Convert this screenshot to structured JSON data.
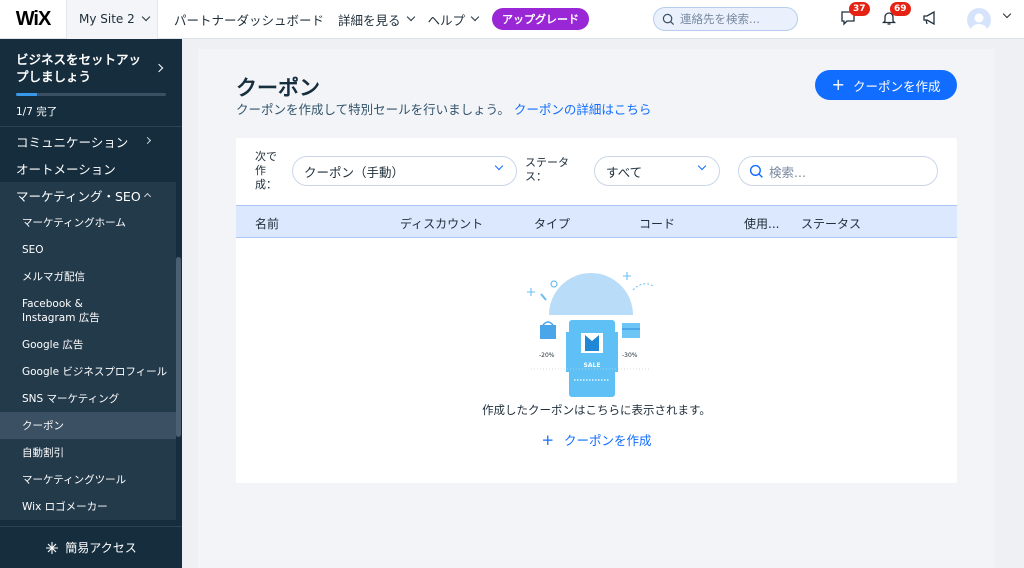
{
  "topbar": {
    "logo": "WiX",
    "site_name": "My Site 2",
    "nav": [
      "パートナーダッシュボード",
      "詳細を見る",
      "ヘルプ"
    ],
    "upgrade": "アップグレード",
    "search_placeholder": "連絡先を検索...",
    "chat_badge": "37",
    "notif_badge": "69"
  },
  "sidebar": {
    "setup_title": "ビジネスをセットアップしましょう",
    "setup_progress": 0.14,
    "setup_count": "1/7 完了",
    "items": [
      "コミュニケーション",
      "オートメーション"
    ],
    "group_label": "マーケティング・SEO",
    "sub_items": [
      "マーケティングホーム",
      "SEO",
      "メルマガ配信",
      "Facebook & Instagram 広告",
      "Google 広告",
      "Google ビジネスプロフィール",
      "SNS マーケティング",
      "クーポン",
      "自動割引",
      "マーケティングツール",
      "Wix ロゴメーカー"
    ],
    "quick_access": "簡易アクセス"
  },
  "page": {
    "title": "クーポン",
    "subtitle": "クーポンを作成して特別セールを行いましょう。",
    "subtitle_link": "クーポンの詳細はこちら",
    "create_button": "クーポンを作成"
  },
  "filters": {
    "type_label": "次で作成：",
    "type_value": "クーポン（手動）",
    "status_label": "ステータス：",
    "status_value": "すべて",
    "search_placeholder": "検索..."
  },
  "table": {
    "columns": [
      "名前",
      "ディスカウント",
      "タイプ",
      "コード",
      "使用...",
      "ステータス"
    ]
  },
  "empty_state": {
    "tag_left": "-20%",
    "tag_right": "-30%",
    "ticket_text": "SALE",
    "message": "作成したクーポンはこちらに表示されます。",
    "create_link": "クーポンを作成"
  }
}
